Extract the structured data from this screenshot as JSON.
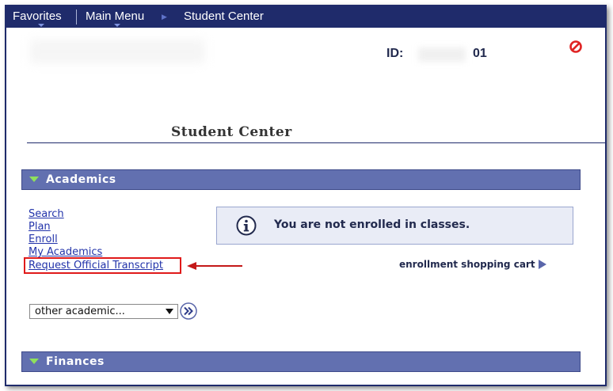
{
  "nav": {
    "favorites": "Favorites",
    "main_menu": "Main Menu",
    "student_center": "Student Center"
  },
  "header": {
    "id_label": "ID:",
    "id_value": "01"
  },
  "page_title": "Student Center",
  "academics": {
    "section_label": "Academics",
    "links": [
      "Search",
      "Plan",
      "Enroll",
      "My Academics",
      "Request Official Transcript"
    ],
    "info_message": "You are not enrolled in classes.",
    "cart_link": "enrollment shopping cart",
    "select_value": "other academic..."
  },
  "finances": {
    "section_label": "Finances"
  },
  "colors": {
    "nav_bg": "#1f2b6b",
    "section_bg": "#6270b0",
    "link": "#2233aa",
    "highlight": "#e01a1a",
    "expand_arrow": "#8fe05c"
  },
  "icons": [
    "stop-icon",
    "info-icon",
    "expand-arrow-icon",
    "cart-arrow-icon",
    "dropdown-caret-icon",
    "go-double-arrow-icon",
    "red-pointer-arrow-icon"
  ]
}
